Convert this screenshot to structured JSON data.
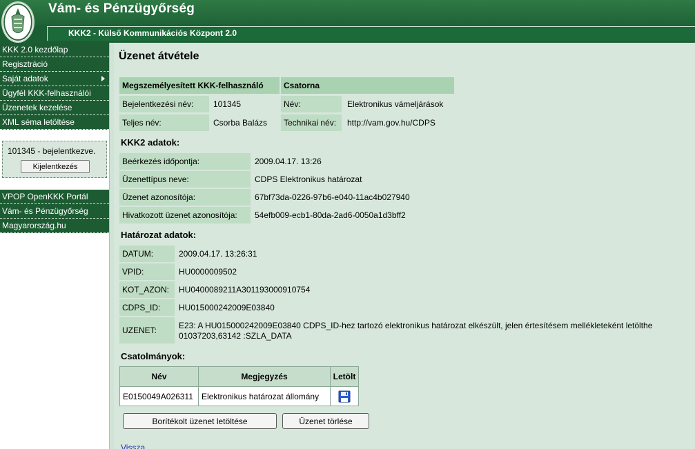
{
  "header": {
    "title": "Vám- és Pénzügyőrség",
    "subtitle": "KKK2 - Külső Kommunikációs Központ 2.0"
  },
  "sidebar": {
    "menu": [
      {
        "label": "KKK 2.0 kezdőlap"
      },
      {
        "label": "Regisztráció"
      },
      {
        "label": "Saját adatok"
      },
      {
        "label": "Ügyfél KKK-felhasználói"
      },
      {
        "label": "Üzenetek kezelése"
      },
      {
        "label": "XML séma letöltése"
      }
    ],
    "login_status": "101345 - bejelentkezve.",
    "logout_label": "Kijelentkezés",
    "links": [
      {
        "label": "VPOP OpenKKK Portál"
      },
      {
        "label": "Vám- és Pénzügyőrség"
      },
      {
        "label": "Magyarország.hu"
      }
    ]
  },
  "main": {
    "title": "Üzenet átvétele",
    "user_header": "Megszemélyesített KKK-felhasználó",
    "channel_header": "Csatorna",
    "login_name_label": "Bejelentkezési név:",
    "login_name": "101345",
    "full_name_label": "Teljes név:",
    "full_name": "Csorba Balázs",
    "channel_name_label": "Név:",
    "channel_name": "Elektronikus vámeljárások",
    "tech_name_label": "Technikai név:",
    "tech_name": "http://vam.gov.hu/CDPS",
    "kkk2_title": "KKK2 adatok:",
    "kkk2": [
      {
        "label": "Beérkezés időpontja:",
        "value": "2009.04.17. 13:26"
      },
      {
        "label": "Üzenettípus neve:",
        "value": "CDPS Elektronikus határozat"
      },
      {
        "label": "Üzenet azonosítója:",
        "value": "67bf73da-0226-97b6-e040-11ac4b027940"
      },
      {
        "label": "Hivatkozott üzenet azonosítója:",
        "value": "54efb009-ecb1-80da-2ad6-0050a1d3bff2"
      }
    ],
    "decision_title": "Határozat adatok:",
    "decision": [
      {
        "label": "DATUM:",
        "value": "2009.04.17. 13:26:31"
      },
      {
        "label": "VPID:",
        "value": "HU0000009502"
      },
      {
        "label": "KOT_AZON:",
        "value": "HU0400089211A301193000910754"
      },
      {
        "label": "CDPS_ID:",
        "value": "HU015000242009E03840"
      }
    ],
    "uzenet_label": "UZENET:",
    "uzenet_line1": "E23: A HU015000242009E03840 CDPS_ID-hez tartozó elektronikus határozat elkészült, jelen értesítésem mellékleteként letölthe",
    "uzenet_line2": "01037203,63142 :SZLA_DATA",
    "attachments_title": "Csatolmányok:",
    "attachments_headers": [
      "Név",
      "Megjegyzés",
      "Letölt"
    ],
    "attachment_name": "E0150049A026311",
    "attachment_note": "Elektronikus határozat állomány",
    "download_envelope_label": "Borítékolt üzenet letöltése",
    "delete_label": "Üzenet törlése",
    "back_label": "Vissza"
  }
}
